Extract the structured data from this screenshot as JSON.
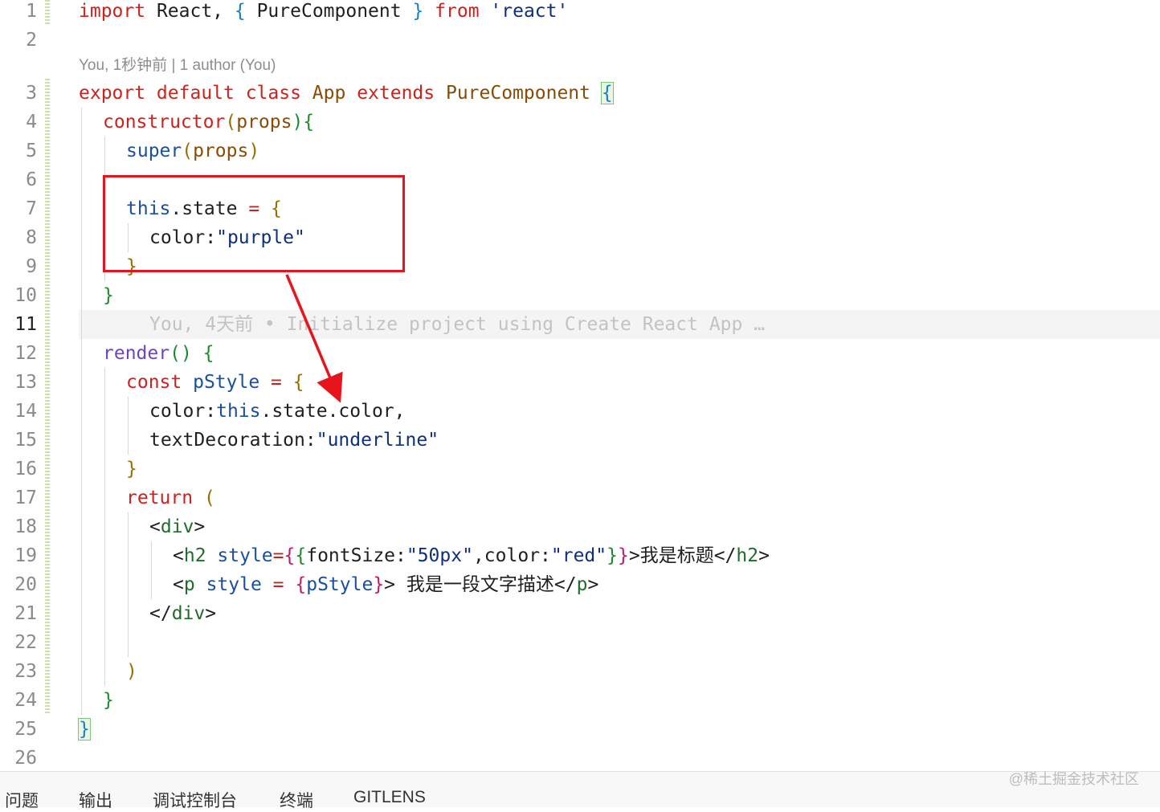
{
  "editor": {
    "code_lens": "You, 1秒钟前 | 1 author (You)",
    "blame_inline": "You, 4天前 • Initialize project using Create React App …",
    "line_numbers": [
      "1",
      "2",
      "3",
      "4",
      "5",
      "6",
      "7",
      "8",
      "9",
      "10",
      "11",
      "12",
      "13",
      "14",
      "15",
      "16",
      "17",
      "18",
      "19",
      "20",
      "21",
      "22",
      "23",
      "24",
      "25",
      "26"
    ],
    "lines": {
      "l1": {
        "a": "import",
        "b": " React, ",
        "c": "{",
        "d": " PureComponent ",
        "e": "}",
        "f": " from ",
        "g": "'react'"
      },
      "l3": {
        "a": "export default class ",
        "b": "App",
        "c": " extends ",
        "d": "PureComponent",
        "e": " ",
        "f": "{"
      },
      "l4": {
        "a": "constructor",
        "b": "(",
        "c": "props",
        "d": "){"
      },
      "l5": {
        "a": "super",
        "b": "(",
        "c": "props",
        "d": ")"
      },
      "l7": {
        "a": "this",
        ".b": ".state ",
        "c": "=",
        "d": " {"
      },
      "l8": {
        "a": "color:",
        "b": "\"purple\""
      },
      "l9": {
        "a": "}"
      },
      "l10": {
        "a": "}"
      },
      "l12": {
        "a": "render",
        "b": "()",
        "c": " {"
      },
      "l13": {
        "a": "const ",
        "b": "pStyle",
        "c": " = ",
        "d": "{"
      },
      "l14": {
        "a": "color:",
        "b": "this",
        "c": ".state.color,"
      },
      "l15": {
        "a": "textDecoration:",
        "b": "\"underline\""
      },
      "l16": {
        "a": "}"
      },
      "l17": {
        "a": "return ",
        "b": "("
      },
      "l18": {
        "a": "<",
        "b": "div",
        ">": ">"
      },
      "l19": {
        "a": "<",
        "b": "h2",
        "c": " style",
        "d": "=",
        "e": "{",
        "f": "{",
        "g": "fontSize:",
        "h": "\"50px\"",
        "i": ",color:",
        "j": "\"red\"",
        "k": "}",
        "l": "}",
        "m": ">我是标题</",
        "n": "h2",
        ">": ">"
      },
      "l20": {
        "a": "<",
        "b": "p",
        "c": " style ",
        "d": "=",
        "e": " {",
        "f": "pStyle",
        "g": "}",
        "h": ">",
        "i": " 我是一段文字描述</",
        "j": "p",
        ">": ">"
      },
      "l21": {
        "a": "</",
        "b": "div",
        ">": ">"
      },
      "l23": {
        "a": ")"
      },
      "l24": {
        "a": "}"
      },
      "l25": {
        "a": "}"
      }
    }
  },
  "panel": {
    "tabs": [
      "问题",
      "输出",
      "调试控制台",
      "终端",
      "GITLENS"
    ]
  },
  "watermark": "@稀土掘金技术社区",
  "colors": {
    "keyword": "#d0211c",
    "string": "#0e2f7d",
    "annotation_red": "#e8141b",
    "bracket_green": "#1e8a2c"
  }
}
